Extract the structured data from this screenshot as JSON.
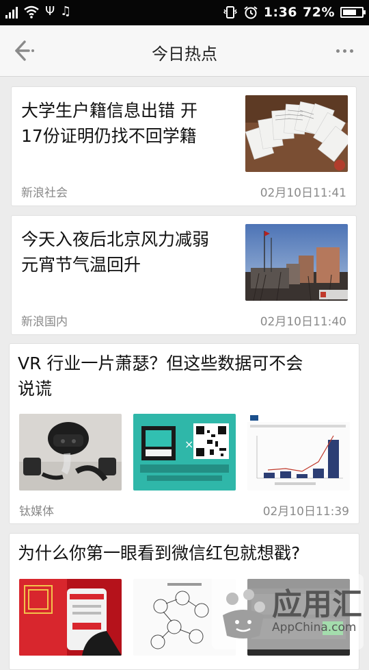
{
  "status_bar": {
    "time": "1:36",
    "battery_percent": "72%",
    "battery_level": 0.72,
    "icons": [
      "signal-icon",
      "wifi-icon",
      "usb-icon",
      "music-icon",
      "vibrate-icon",
      "alarm-icon",
      "battery-icon"
    ]
  },
  "header": {
    "title": "今日热点",
    "back_icon": "back-arrow-icon",
    "more_icon": "more-dots-icon"
  },
  "articles": [
    {
      "headline": "大学生户籍信息出错 开\n17份证明仍找不回学籍",
      "source": "新浪社会",
      "time": "02月10日11:41",
      "image": "documents-photo"
    },
    {
      "headline": "今天入夜后北京风力减弱\n元宵节气温回升",
      "source": "新浪国内",
      "time": "02月10日11:40",
      "image": "beijing-buildings-photo"
    },
    {
      "headline": "VR 行业一片萧瑟？但这些数据可不会\n说谎",
      "source": "钛媒体",
      "time": "02月10日11:39",
      "images": [
        "vr-headset-photo",
        "qr-code-promo",
        "idc-bar-chart"
      ]
    },
    {
      "headline": "为什么你第一眼看到微信红包就想戳?",
      "images": [
        "red-envelope-phone-photo",
        "sketch-diagram",
        "phone-screenshot"
      ]
    }
  ],
  "watermark": {
    "title": "应用汇",
    "subtitle": "AppChina.com"
  }
}
